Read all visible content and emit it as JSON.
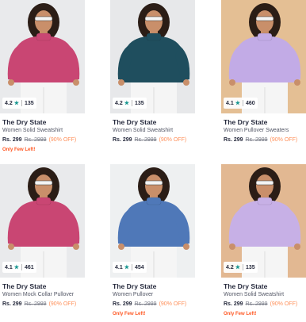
{
  "products": [
    {
      "brand": "The Dry State",
      "title": "Women Solid Sweatshirt",
      "rating": "4.2",
      "reviews": "135",
      "price": "Rs. 299",
      "mrp": "Rs. 2999",
      "discount": "(90% OFF)",
      "stock": "Only Few Left!",
      "bg": "#e9eaec",
      "garment": "#c94673",
      "star_icon": "star-icon"
    },
    {
      "brand": "The Dry State",
      "title": "Women Solid Sweatshirt",
      "rating": "4.2",
      "reviews": "135",
      "price": "Rs. 299",
      "mrp": "Rs. 2999",
      "discount": "(90% OFF)",
      "stock": "",
      "bg": "#e7e8ea",
      "garment": "#1f4e5e",
      "star_icon": "star-icon"
    },
    {
      "brand": "The Dry State",
      "title": "Women Pullover Sweaters",
      "rating": "4.1",
      "reviews": "460",
      "price": "Rs. 299",
      "mrp": "Rs. 2999",
      "discount": "(90% OFF)",
      "stock": "",
      "bg": "#e4bf94",
      "garment": "#c2abe6",
      "star_icon": "star-icon"
    },
    {
      "brand": "The Dry State",
      "title": "Women Mock Collar Pullover",
      "rating": "4.1",
      "reviews": "461",
      "price": "Rs. 299",
      "mrp": "Rs. 2999",
      "discount": "(90% OFF)",
      "stock": "",
      "bg": "#e9eaec",
      "garment": "#c94673",
      "star_icon": "star-icon"
    },
    {
      "brand": "The Dry State",
      "title": "Women Pullover",
      "rating": "4.1",
      "reviews": "454",
      "price": "Rs. 299",
      "mrp": "Rs. 2999",
      "discount": "(90% OFF)",
      "stock": "Only Few Left!",
      "bg": "#eef0f1",
      "garment": "#4f78b8",
      "star_icon": "star-icon"
    },
    {
      "brand": "The Dry State",
      "title": "Women Solid Sweatshirt",
      "rating": "4.2",
      "reviews": "135",
      "price": "Rs. 299",
      "mrp": "Rs. 2999",
      "discount": "(90% OFF)",
      "stock": "Only Few Left!",
      "bg": "#e2b892",
      "garment": "#c7b0e6",
      "star_icon": "star-icon"
    }
  ]
}
